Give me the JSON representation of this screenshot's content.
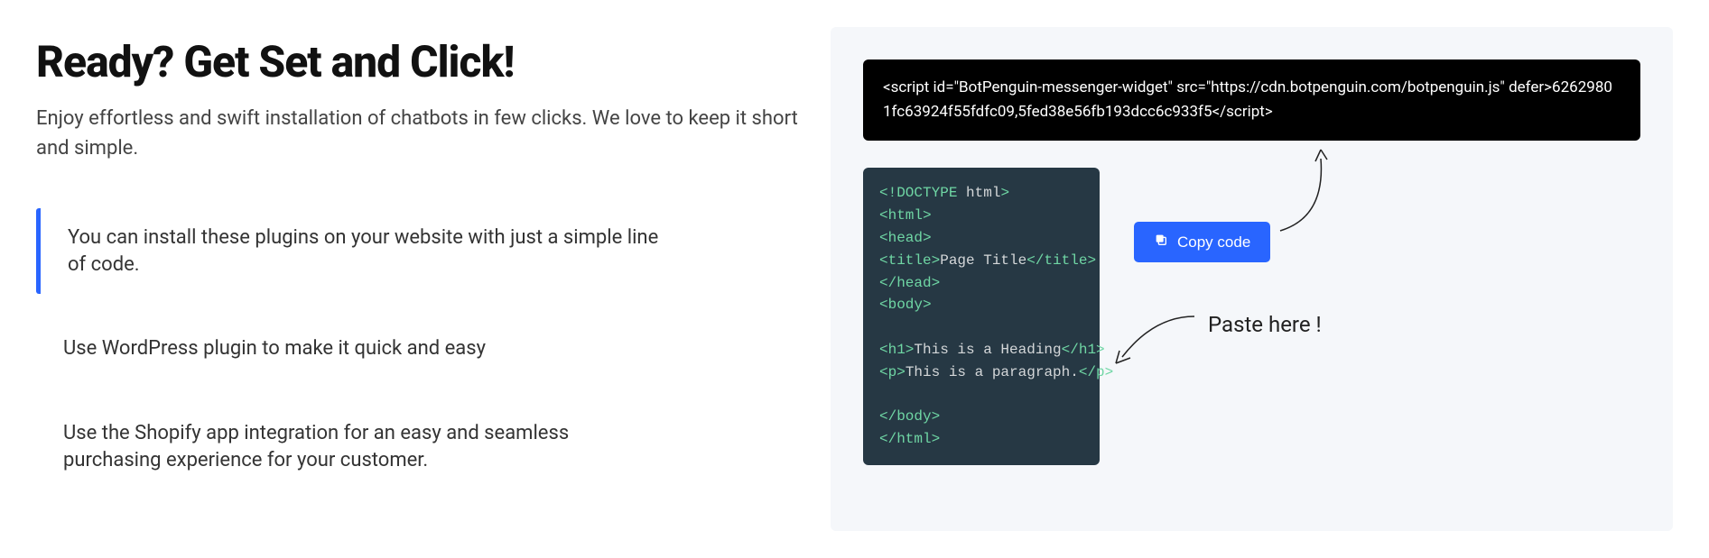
{
  "left": {
    "title": "Ready? Get Set and Click!",
    "subtitle": "Enjoy effortless and swift installation of chatbots in few clicks. We love to keep it short and simple.",
    "features": [
      "You can install these plugins on your website with just a simple line of code.",
      "Use WordPress plugin to make it quick and easy",
      "Use the Shopify app integration for an easy and seamless purchasing experience for your customer."
    ]
  },
  "right": {
    "snippet": "<script id=\"BotPenguin-messenger-widget\" src=\"https://cdn.botpenguin.com/botpenguin.js\" defer>62629801fc63924f55fdfc09,5fed38e56fb193dcc6c933f5</script>",
    "copy_label": "Copy code",
    "paste_label": "Paste here !",
    "html_lines": {
      "l0a": "<!DOCTYPE",
      "l0b": " html",
      "l0c": ">",
      "l1a": "<html>",
      "l2a": "<head>",
      "l3a": "<title>",
      "l3b": "Page Title",
      "l3c": "</title>",
      "l4a": "</head>",
      "l5a": "<body>",
      "l6": "",
      "l7a": "<h1>",
      "l7b": "This is a Heading",
      "l7c": "</h1>",
      "l8a": "<p>",
      "l8b": "This is a paragraph.",
      "l8c": "</p>",
      "l9": "",
      "l10a": "</body>",
      "l11a": "</html>"
    }
  }
}
